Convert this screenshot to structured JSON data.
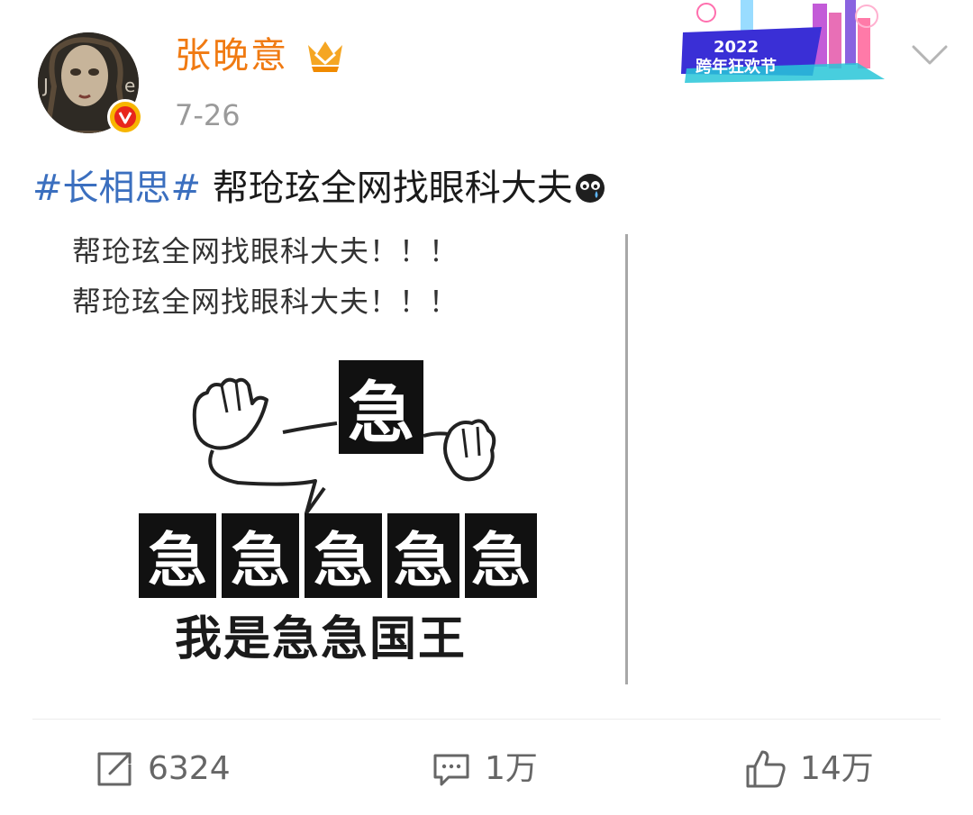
{
  "post": {
    "author": "张晚意",
    "time": "7-26",
    "hashtag": "#长相思#",
    "text": " 帮玱玹全网找眼科大夫"
  },
  "image": {
    "line1": "帮玱玹全网找眼科大夫！！！",
    "line2": "帮玱玹全网找眼科大夫！！！",
    "big_char": "急",
    "row_chars": [
      "急",
      "急",
      "急",
      "急",
      "急"
    ],
    "caption": "我是急急国王"
  },
  "banner": {
    "year": "2022",
    "label": "跨年狂欢节"
  },
  "actions": {
    "repost": "6324",
    "comment": "1万",
    "like": "14万"
  },
  "colors": {
    "username": "#f07a12",
    "hashtag": "#3b6fbf",
    "verified": "#f7b500"
  },
  "icons": [
    "verified-badge-icon",
    "member-badge-icon",
    "chevron-down-icon",
    "crying-emoji-icon",
    "repost-icon",
    "comment-icon",
    "like-icon"
  ]
}
